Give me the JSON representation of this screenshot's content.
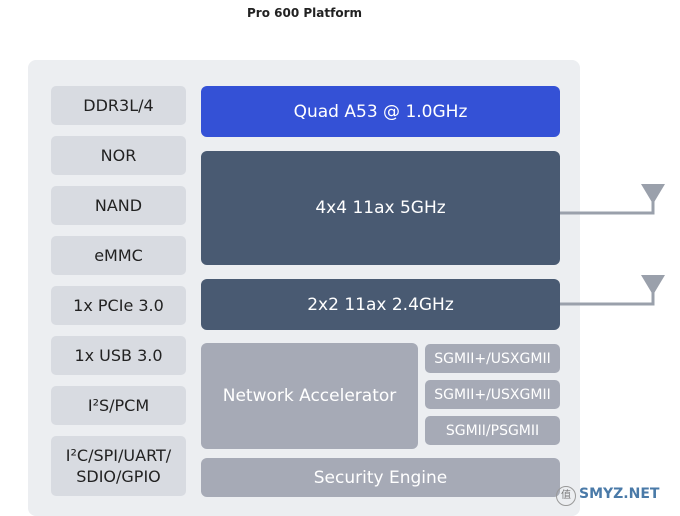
{
  "title": "Pro 600 Platform",
  "interfaces": [
    "DDR3L/4",
    "NOR",
    "NAND",
    "eMMC",
    "1x PCIe 3.0",
    "1x USB 3.0",
    "I²S/PCM",
    "I²C/SPI/UART/",
    "SDIO/GPIO"
  ],
  "blocks": {
    "cpu": "Quad A53 @ 1.0GHz",
    "wifi5": "4x4 11ax 5GHz",
    "wifi24": "2x2 11ax 2.4GHz",
    "network_accelerator": "Network Accelerator",
    "ports": [
      "SGMII+/USXGMII",
      "SGMII+/USXGMII",
      "SGMII/PSGMII"
    ],
    "security": "Security Engine"
  },
  "watermark": {
    "glyph": "值",
    "text": "SMYZ.NET"
  },
  "colors": {
    "cpu": "#3451d6",
    "wifi": "#495a72",
    "gray_block": "#a6aab6",
    "interface": "#d8dbe1",
    "panel": "#eceef1",
    "antenna": "#9aa0ab"
  }
}
